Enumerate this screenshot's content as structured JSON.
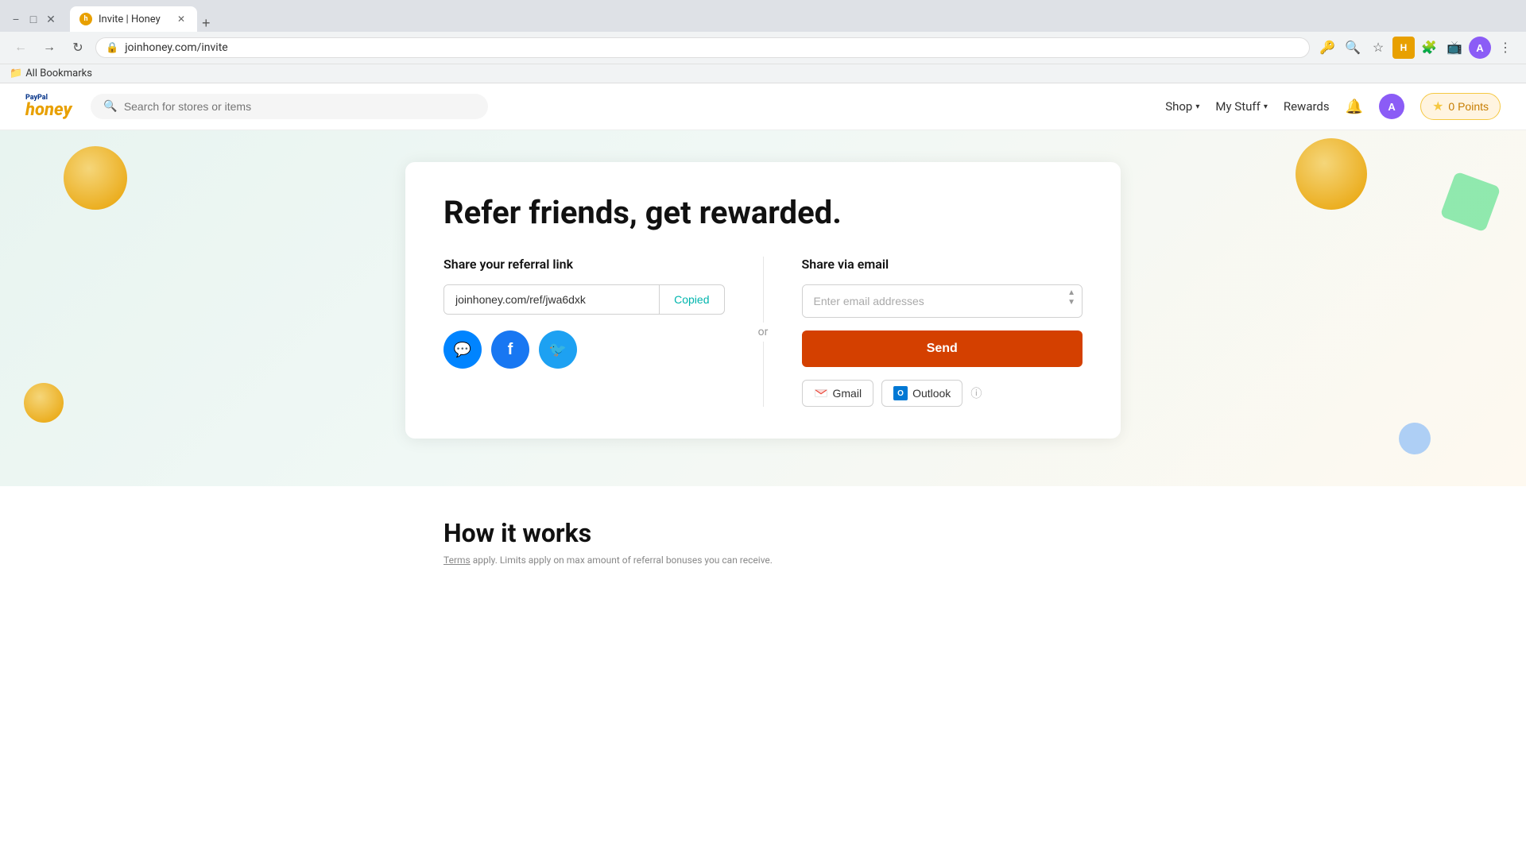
{
  "browser": {
    "tab_title": "Invite | Honey",
    "url": "joinhoney.com/invite",
    "new_tab_label": "+",
    "back_disabled": false,
    "forward_disabled": true
  },
  "nav": {
    "logo_paypal": "PayPal",
    "logo_honey": "honey",
    "search_placeholder": "Search for stores or items",
    "shop_label": "Shop",
    "mystuff_label": "My Stuff",
    "rewards_label": "Rewards",
    "points_label": "0 Points",
    "bookmarks_label": "All Bookmarks"
  },
  "hero": {
    "title": "Refer friends, get rewarded.",
    "share_link_title": "Share your referral link",
    "referral_url": "joinhoney.com/ref/jwa6dxk",
    "copy_label": "Copied",
    "or_label": "or",
    "messenger_icon": "💬",
    "facebook_icon": "f",
    "twitter_icon": "🐦",
    "share_email_title": "Share via email",
    "email_placeholder": "Enter email addresses",
    "send_label": "Send",
    "gmail_label": "Gmail",
    "outlook_label": "Outlook"
  },
  "how": {
    "title": "How it works",
    "terms_text": "Terms",
    "terms_note": " apply. Limits apply on max amount of referral bonuses you can receive."
  }
}
